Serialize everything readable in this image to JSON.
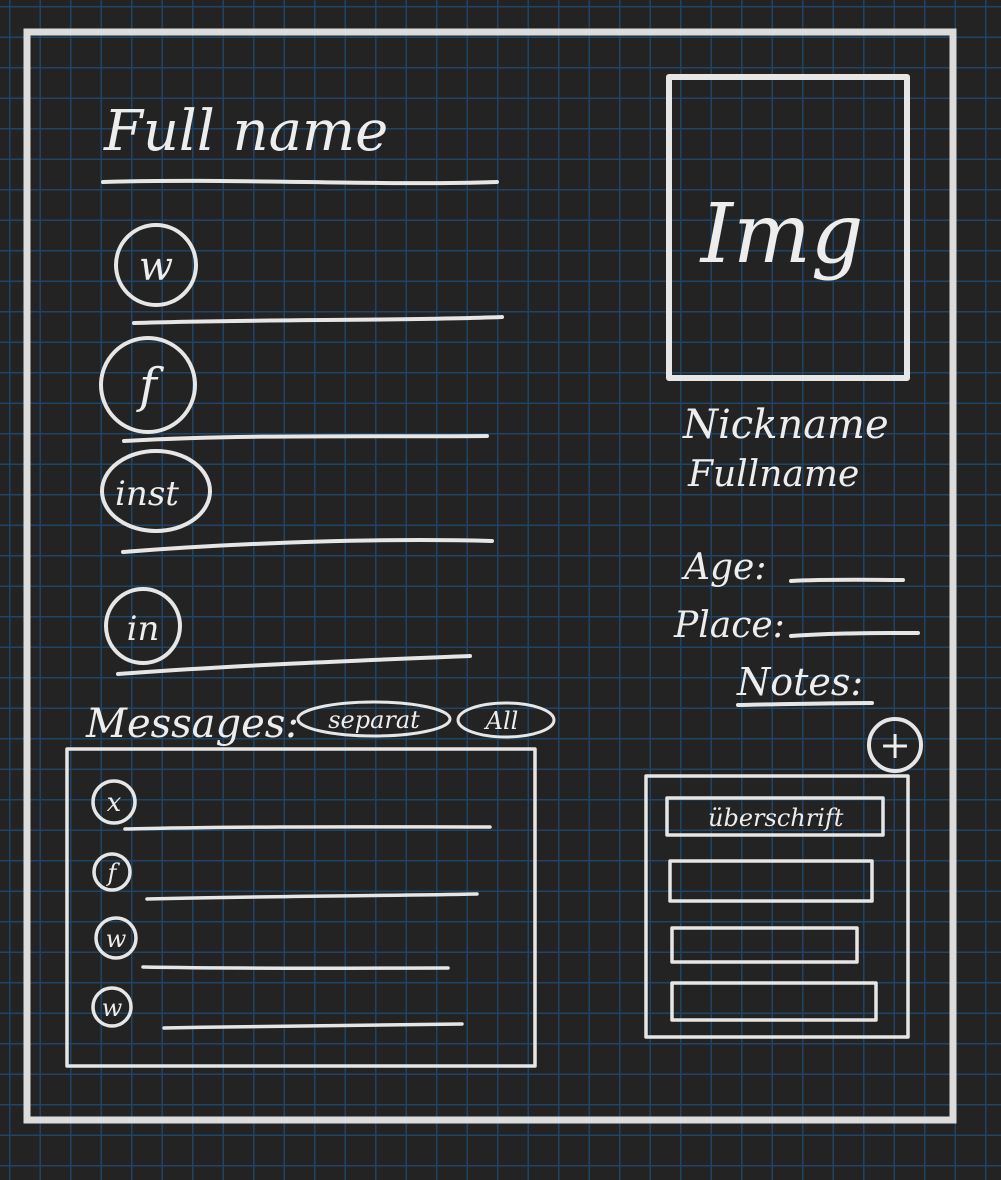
{
  "header": {
    "title": "Full name"
  },
  "social": [
    {
      "icon": "whatsapp-icon",
      "glyph": "w"
    },
    {
      "icon": "facebook-icon",
      "glyph": "f"
    },
    {
      "icon": "instagram-icon",
      "glyph": "inst"
    },
    {
      "icon": "linkedin-icon",
      "glyph": "in"
    }
  ],
  "messages": {
    "label": "Messages:",
    "filter_separate": "separat",
    "filter_all": "All",
    "items": [
      {
        "icon": "x-icon",
        "glyph": "x"
      },
      {
        "icon": "facebook-icon",
        "glyph": "f"
      },
      {
        "icon": "whatsapp-icon",
        "glyph": "w"
      },
      {
        "icon": "whatsapp-icon",
        "glyph": "w"
      }
    ]
  },
  "profile": {
    "image_label": "Img",
    "nickname": "Nickname",
    "fullname": "Fullname",
    "age_label": "Age:",
    "place_label": "Place:",
    "notes_label": "Notes:"
  },
  "notes": {
    "add": "+",
    "heading": "überschrift"
  }
}
